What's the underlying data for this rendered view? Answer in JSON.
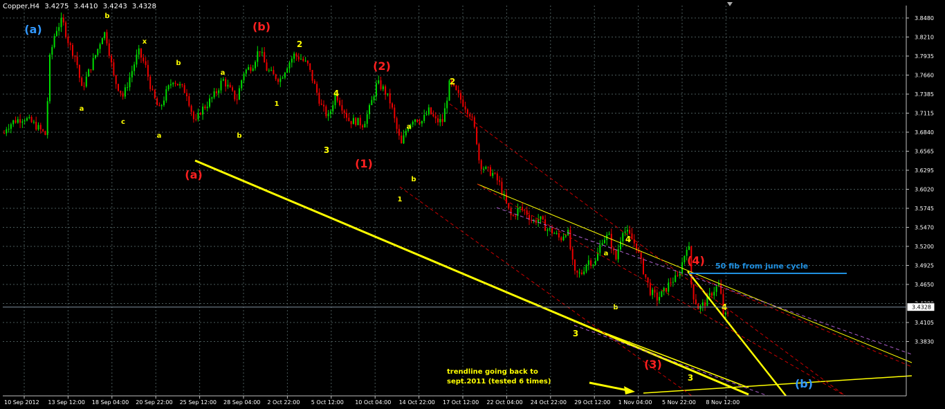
{
  "header": {
    "symbol": "Copper,H4",
    "open": "3.4275",
    "high": "3.4410",
    "low": "3.4243",
    "close": "3.4328"
  },
  "colors": {
    "background": "#000000",
    "grid": "#4a5a5a",
    "bull": "#00dd00",
    "bear": "#ee0000",
    "trend_yellow": "#ffff00",
    "channel_red": "#cc0000",
    "channel_purple": "#b060d0",
    "fib_blue": "#2090e0",
    "text_white": "#ffffff"
  },
  "chart_data": {
    "type": "candlestick",
    "instrument": "Copper",
    "timeframe": "H4",
    "ylim": [
      3.83,
      3.858
    ],
    "y_ticks": [
      "3.8480",
      "3.8210",
      "3.7935",
      "3.7660",
      "3.7385",
      "3.7115",
      "3.6840",
      "3.6565",
      "3.6295",
      "3.6020",
      "3.5745",
      "3.5470",
      "3.5200",
      "3.4925",
      "3.4650",
      "3.4380",
      "3.4105",
      "3.3830"
    ],
    "x_ticks": [
      "10 Sep 2012",
      "13 Sep 12:00",
      "18 Sep 04:00",
      "20 Sep 22:00",
      "25 Sep 12:00",
      "28 Sep 04:00",
      "2 Oct 22:00",
      "5 Oct 12:00",
      "10 Oct 04:00",
      "14 Oct 22:00",
      "17 Oct 12:00",
      "22 Oct 04:00",
      "24 Oct 22:00",
      "29 Oct 12:00",
      "1 Nov 04:00",
      "5 Nov 22:00",
      "8 Nov 12:00"
    ],
    "current_price": "3.4328",
    "grid": true,
    "price_path": [
      [
        0,
        3.66
      ],
      [
        8,
        3.69
      ],
      [
        20,
        3.7
      ],
      [
        35,
        3.705
      ],
      [
        50,
        3.695
      ],
      [
        66,
        3.68
      ],
      [
        72,
        3.79
      ],
      [
        80,
        3.83
      ],
      [
        90,
        3.845
      ],
      [
        100,
        3.81
      ],
      [
        110,
        3.79
      ],
      [
        118,
        3.745
      ],
      [
        128,
        3.77
      ],
      [
        140,
        3.8
      ],
      [
        150,
        3.83
      ],
      [
        155,
        3.815
      ],
      [
        165,
        3.76
      ],
      [
        178,
        3.735
      ],
      [
        190,
        3.77
      ],
      [
        200,
        3.8
      ],
      [
        210,
        3.78
      ],
      [
        220,
        3.74
      ],
      [
        230,
        3.715
      ],
      [
        240,
        3.74
      ],
      [
        250,
        3.76
      ],
      [
        260,
        3.75
      ],
      [
        270,
        3.74
      ],
      [
        282,
        3.695
      ],
      [
        290,
        3.715
      ],
      [
        300,
        3.725
      ],
      [
        312,
        3.74
      ],
      [
        322,
        3.76
      ],
      [
        332,
        3.745
      ],
      [
        342,
        3.73
      ],
      [
        352,
        3.77
      ],
      [
        365,
        3.78
      ],
      [
        375,
        3.805
      ],
      [
        385,
        3.775
      ],
      [
        395,
        3.765
      ],
      [
        405,
        3.76
      ],
      [
        415,
        3.78
      ],
      [
        425,
        3.795
      ],
      [
        435,
        3.79
      ],
      [
        445,
        3.78
      ],
      [
        455,
        3.75
      ],
      [
        465,
        3.72
      ],
      [
        475,
        3.705
      ],
      [
        485,
        3.74
      ],
      [
        495,
        3.72
      ],
      [
        505,
        3.7
      ],
      [
        515,
        3.7
      ],
      [
        525,
        3.695
      ],
      [
        535,
        3.72
      ],
      [
        545,
        3.755
      ],
      [
        555,
        3.745
      ],
      [
        565,
        3.725
      ],
      [
        573,
        3.69
      ],
      [
        580,
        3.665
      ],
      [
        588,
        3.69
      ],
      [
        598,
        3.705
      ],
      [
        610,
        3.7
      ],
      [
        620,
        3.715
      ],
      [
        630,
        3.7
      ],
      [
        640,
        3.7
      ],
      [
        650,
        3.755
      ],
      [
        660,
        3.74
      ],
      [
        670,
        3.725
      ],
      [
        680,
        3.71
      ],
      [
        688,
        3.68
      ],
      [
        693,
        3.64
      ],
      [
        702,
        3.63
      ],
      [
        712,
        3.625
      ],
      [
        722,
        3.61
      ],
      [
        732,
        3.58
      ],
      [
        740,
        3.56
      ],
      [
        750,
        3.575
      ],
      [
        760,
        3.57
      ],
      [
        770,
        3.555
      ],
      [
        780,
        3.56
      ],
      [
        790,
        3.545
      ],
      [
        800,
        3.54
      ],
      [
        810,
        3.53
      ],
      [
        820,
        3.545
      ],
      [
        830,
        3.48
      ],
      [
        840,
        3.48
      ],
      [
        850,
        3.5
      ],
      [
        860,
        3.495
      ],
      [
        870,
        3.53
      ],
      [
        880,
        3.535
      ],
      [
        890,
        3.5
      ],
      [
        900,
        3.545
      ],
      [
        910,
        3.535
      ],
      [
        920,
        3.52
      ],
      [
        930,
        3.485
      ],
      [
        940,
        3.455
      ],
      [
        950,
        3.445
      ],
      [
        960,
        3.455
      ],
      [
        970,
        3.47
      ],
      [
        980,
        3.475
      ],
      [
        990,
        3.51
      ],
      [
        995,
        3.53
      ],
      [
        1000,
        3.455
      ],
      [
        1010,
        3.43
      ],
      [
        1020,
        3.44
      ],
      [
        1030,
        3.455
      ],
      [
        1040,
        3.465
      ],
      [
        1046,
        3.42
      ],
      [
        1052,
        3.42
      ],
      [
        1056,
        3.43
      ]
    ]
  },
  "annotations": {
    "wave_labels": [
      {
        "text": "(a)",
        "color": "#3399ff",
        "size": "big"
      },
      {
        "text": "(b)",
        "color": "#ff2020",
        "size": "big"
      },
      {
        "text": "(2)",
        "color": "#ff2020",
        "size": "big"
      },
      {
        "text": "(1)",
        "color": "#ff2020",
        "size": "big"
      },
      {
        "text": "(a)",
        "color": "#ff2020",
        "size": "big"
      },
      {
        "text": "(3)",
        "color": "#ff2020",
        "size": "big"
      },
      {
        "text": "(4)",
        "color": "#ff2020",
        "size": "big"
      },
      {
        "text": "(b)",
        "color": "#3399ff",
        "size": "big"
      },
      {
        "text": "2",
        "color": "#ffff00",
        "size": "mid"
      },
      {
        "text": "2",
        "color": "#ffff00",
        "size": "mid"
      },
      {
        "text": "4",
        "color": "#ffff00",
        "size": "mid"
      },
      {
        "text": "4",
        "color": "#ffff00",
        "size": "mid"
      },
      {
        "text": "4",
        "color": "#ffff00",
        "size": "mid"
      },
      {
        "text": "3",
        "color": "#ffff00",
        "size": "mid"
      },
      {
        "text": "3",
        "color": "#ffff00",
        "size": "mid"
      },
      {
        "text": "3",
        "color": "#ffff00",
        "size": "mid"
      },
      {
        "text": "1",
        "color": "#ffff00",
        "size": "sm"
      },
      {
        "text": "1",
        "color": "#ffff00",
        "size": "sm"
      },
      {
        "text": "b",
        "color": "#ffff00",
        "size": "sm"
      },
      {
        "text": "x",
        "color": "#ffff00",
        "size": "sm"
      },
      {
        "text": "a",
        "color": "#ffff00",
        "size": "sm"
      },
      {
        "text": "c",
        "color": "#ffff00",
        "size": "sm"
      },
      {
        "text": "a",
        "color": "#ffff00",
        "size": "sm"
      },
      {
        "text": "b",
        "color": "#ffff00",
        "size": "sm"
      },
      {
        "text": "a",
        "color": "#ffff00",
        "size": "sm"
      },
      {
        "text": "b",
        "color": "#ffff00",
        "size": "sm"
      },
      {
        "text": "a",
        "color": "#ffff00",
        "size": "sm"
      },
      {
        "text": "b",
        "color": "#ffff00",
        "size": "sm"
      },
      {
        "text": "a",
        "color": "#ffff00",
        "size": "sm"
      },
      {
        "text": "b",
        "color": "#ffff00",
        "size": "sm"
      }
    ],
    "fib_note": "50 fib from june cycle",
    "trendline_note_line1": "trendline going back to",
    "trendline_note_line2": "sept.2011 (tested 6 times)"
  }
}
